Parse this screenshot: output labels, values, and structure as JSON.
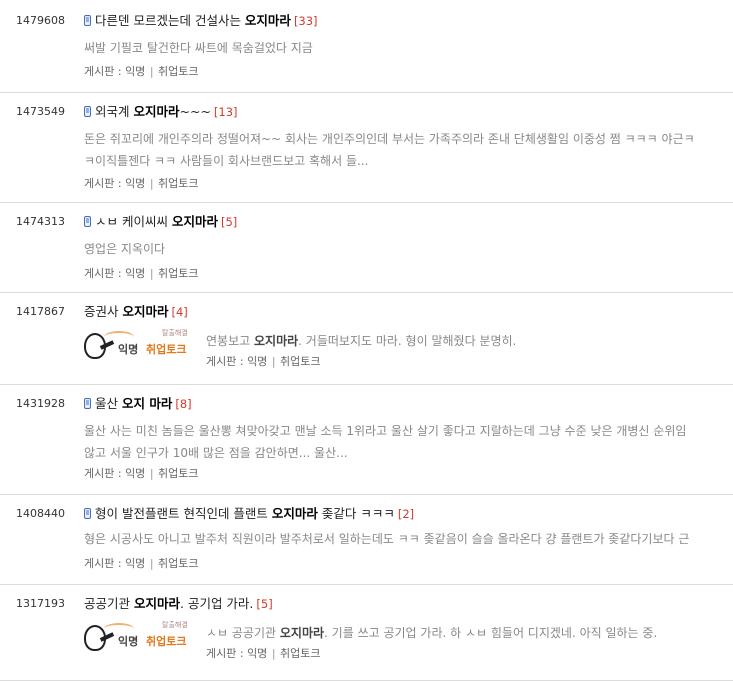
{
  "posts": [
    {
      "id": "1479608",
      "mobile": true,
      "title_pre": "다른덴 모르겠는데 건설사는 ",
      "title_kw": "오지마라",
      "title_post": "",
      "count": "[33]",
      "snippet_pre": "써발 기필코 탈건한다 싸트에 목숨걸었다 지금",
      "snippet_kw": "",
      "snippet_post": "",
      "snippet2": "",
      "meta_prefix": "게시판 : ",
      "board": "익명",
      "sep": "|",
      "category": "취업토크"
    },
    {
      "id": "1473549",
      "mobile": true,
      "title_pre": "외국계 ",
      "title_kw": "오지마라",
      "title_post": "~~~",
      "count": "[13]",
      "snippet_pre": "돈은 쥐꼬리에 개인주의라 정떨어져~~ 회사는 개인주의인데 부서는 가족주의라 존내 단체생활임 이중성 쩜 ㅋㅋㅋ 야근ㅋ",
      "snippet_kw": "",
      "snippet_post": "",
      "snippet2": "ㅋ이직틀젠다 ㅋㅋ 사람들이 회사브랜드보고 혹해서 들...",
      "meta_prefix": "게시판 : ",
      "board": "익명",
      "sep": "|",
      "category": "취업토크"
    },
    {
      "id": "1474313",
      "mobile": true,
      "title_pre": "ㅅㅂ 케이씨씨 ",
      "title_kw": "오지마라",
      "title_post": "",
      "count": "[5]",
      "snippet_pre": "영업은 지옥이다",
      "snippet_kw": "",
      "snippet_post": "",
      "snippet2": "",
      "meta_prefix": "게시판 : ",
      "board": "익명",
      "sep": "|",
      "category": "취업토크"
    },
    {
      "id": "1417867",
      "mobile": false,
      "thumb": true,
      "title_pre": "증권사 ",
      "title_kw": "오지마라",
      "title_post": "",
      "count": "[4]",
      "snippet_pre": "연봉보고 ",
      "snippet_kw": "오지마라",
      "snippet_post": ". 거들떠보지도 마라. 형이 말해줬다 분명히.",
      "snippet2": "",
      "meta_prefix": "게시판 : ",
      "board": "익명",
      "sep": "|",
      "category": "취업토크"
    },
    {
      "id": "1431928",
      "mobile": true,
      "title_pre": "울산 ",
      "title_kw": "오지 마라",
      "title_post": "",
      "count": "[8]",
      "snippet_pre": "울산 사는 미친 놈들은 울산뽕 쳐맞아갖고 맨날 소득 1위라고 울산 살기 좋다고 지랄하는데 그냥 수준 낮은 개병신 순위임",
      "snippet_kw": "",
      "snippet_post": "",
      "snippet2": "않고 서울 인구가 10배 많은 점을 감안하면... 울산...",
      "meta_prefix": "게시판 : ",
      "board": "익명",
      "sep": "|",
      "category": "취업토크"
    },
    {
      "id": "1408440",
      "mobile": true,
      "title_pre": "형이 발전플랜트 현직인데 플랜트 ",
      "title_kw": "오지마라",
      "title_post": " 좆같다 ㅋㅋㅋ",
      "count": "[2]",
      "snippet_pre": "형은 시공사도 아니고 발주처 직원이라 발주처로서 일하는데도 ㅋㅋ 좆같음이 슬슬 올라온다 걍 플랜트가 좆같다기보다 근",
      "snippet_kw": "",
      "snippet_post": "",
      "snippet2": "",
      "meta_prefix": "게시판 : ",
      "board": "익명",
      "sep": "|",
      "category": "취업토크"
    },
    {
      "id": "1317193",
      "mobile": false,
      "thumb": true,
      "title_pre": "공공기관 ",
      "title_kw": "오지마라",
      "title_post": ". 공기업 가라.",
      "count": "[5]",
      "snippet_pre": "ㅅㅂ 공공기관 ",
      "snippet_kw": "오지마라",
      "snippet_post": ". 기를 쓰고 공기업 가라. 하 ㅅㅂ 힘들어 디지겠네. 아직 일하는 중.",
      "snippet2": "",
      "meta_prefix": "게시판 : ",
      "board": "익명",
      "sep": "|",
      "category": "취업토크"
    }
  ],
  "thumb": {
    "word1": "익명",
    "word2": "취업토크",
    "tiny": "탈출해결"
  }
}
